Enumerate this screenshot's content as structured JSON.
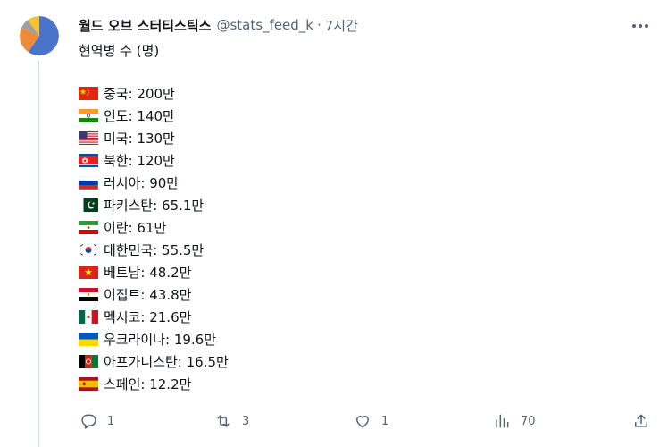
{
  "tweet": {
    "display_name": "월드 오브 스터티스틱스",
    "handle": "@stats_feed_k",
    "dot": "·",
    "time": "7시간",
    "title": "현역병 수 (명)",
    "rows": [
      {
        "text": "중국: 200만",
        "flag": "china-flag-icon"
      },
      {
        "text": "인도: 140만",
        "flag": "india-flag-icon"
      },
      {
        "text": "미국: 130만",
        "flag": "usa-flag-icon"
      },
      {
        "text": "북한: 120만",
        "flag": "north-korea-flag-icon"
      },
      {
        "text": "러시아: 90만",
        "flag": "russia-flag-icon"
      },
      {
        "text": "파키스탄: 65.1만",
        "flag": "pakistan-flag-icon"
      },
      {
        "text": "이란: 61만",
        "flag": "iran-flag-icon"
      },
      {
        "text": "대한민국: 55.5만",
        "flag": "south-korea-flag-icon"
      },
      {
        "text": "베트남: 48.2만",
        "flag": "vietnam-flag-icon"
      },
      {
        "text": "이집트: 43.8만",
        "flag": "egypt-flag-icon"
      },
      {
        "text": "멕시코: 21.6만",
        "flag": "mexico-flag-icon"
      },
      {
        "text": "우크라이나: 19.6만",
        "flag": "ukraine-flag-icon"
      },
      {
        "text": "아프가니스탄: 16.5만",
        "flag": "afghanistan-flag-icon"
      },
      {
        "text": "스페인: 12.2만",
        "flag": "spain-flag-icon"
      }
    ],
    "actions": {
      "replies": "1",
      "retweets": "3",
      "likes": "1",
      "views": "70"
    }
  },
  "icons": {
    "avatar": "pie-chart-avatar-icon",
    "more": "more-horizontal-icon",
    "reply": "reply-icon",
    "retweet": "retweet-icon",
    "like": "heart-icon",
    "views": "views-bar-chart-icon",
    "share": "share-icon"
  },
  "colors": {
    "text": "#0f1419",
    "secondary": "#536471",
    "thread_line": "#cfd9de"
  }
}
